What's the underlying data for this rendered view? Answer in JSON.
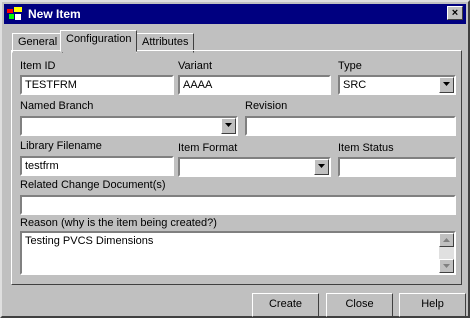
{
  "window": {
    "title": "New Item",
    "close_glyph": "×"
  },
  "tabs": [
    {
      "label": "General",
      "active": false
    },
    {
      "label": "Configuration",
      "active": true
    },
    {
      "label": "Attributes",
      "active": false
    }
  ],
  "fields": {
    "item_id": {
      "label": "Item ID",
      "value": "TESTFRM"
    },
    "variant": {
      "label": "Variant",
      "value": "AAAA"
    },
    "type": {
      "label": "Type",
      "value": "SRC"
    },
    "named_branch": {
      "label": "Named Branch",
      "value": ""
    },
    "revision": {
      "label": "Revision",
      "value": ""
    },
    "library_filename": {
      "label": "Library Filename",
      "value": "testfrm"
    },
    "item_format": {
      "label": "Item Format",
      "value": ""
    },
    "item_status": {
      "label": "Item Status",
      "value": ""
    },
    "related_change": {
      "label": "Related Change Document(s)",
      "value": ""
    },
    "reason": {
      "label": "Reason (why is the item being created?)",
      "value": "Testing PVCS Dimensions"
    }
  },
  "buttons": {
    "create": "Create",
    "close": "Close",
    "help": "Help"
  },
  "icons": {
    "app": "app-icon",
    "dropdown": "chevron-down-icon"
  }
}
